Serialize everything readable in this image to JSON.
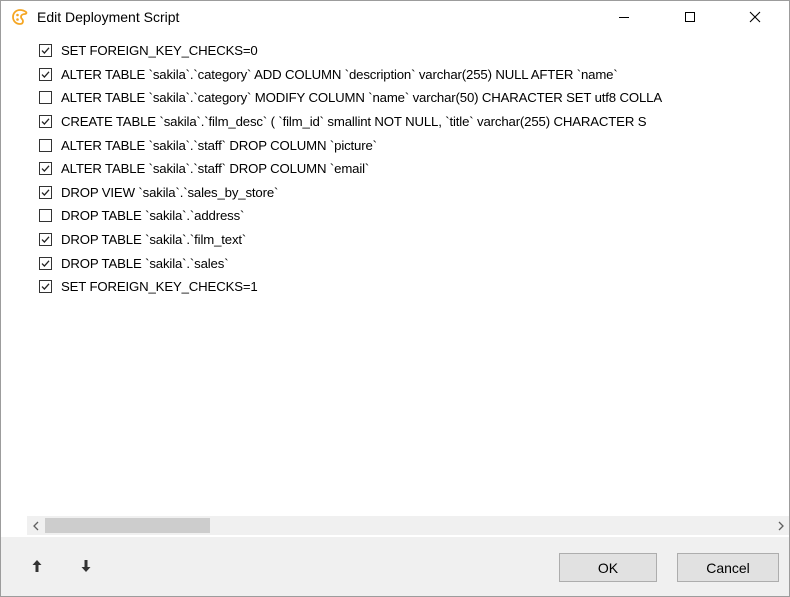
{
  "window": {
    "title": "Edit Deployment Script",
    "icon": "app-logo-icon"
  },
  "statements": [
    {
      "checked": true,
      "text": "SET FOREIGN_KEY_CHECKS=0"
    },
    {
      "checked": true,
      "text": "ALTER TABLE `sakila`.`category` ADD COLUMN `description` varchar(255) NULL AFTER `name`"
    },
    {
      "checked": false,
      "text": "ALTER TABLE `sakila`.`category` MODIFY COLUMN `name` varchar(50) CHARACTER SET utf8 COLLA"
    },
    {
      "checked": true,
      "text": "CREATE TABLE `sakila`.`film_desc`  (  `film_id` smallint NOT NULL,  `title` varchar(255) CHARACTER S"
    },
    {
      "checked": false,
      "text": "ALTER TABLE `sakila`.`staff` DROP COLUMN `picture`"
    },
    {
      "checked": true,
      "text": "ALTER TABLE `sakila`.`staff` DROP COLUMN `email`"
    },
    {
      "checked": true,
      "text": "DROP VIEW `sakila`.`sales_by_store`"
    },
    {
      "checked": false,
      "text": "DROP TABLE `sakila`.`address`"
    },
    {
      "checked": true,
      "text": "DROP TABLE `sakila`.`film_text`"
    },
    {
      "checked": true,
      "text": "DROP TABLE `sakila`.`sales`"
    },
    {
      "checked": true,
      "text": "SET FOREIGN_KEY_CHECKS=1"
    }
  ],
  "footer": {
    "move_up_icon": "arrow-up-icon",
    "move_down_icon": "arrow-down-icon",
    "ok_label": "OK",
    "cancel_label": "Cancel"
  },
  "colors": {
    "footer_bg": "#f0f0f0",
    "scroll_thumb": "#cdcdcd",
    "app_icon": "#f5a623"
  }
}
